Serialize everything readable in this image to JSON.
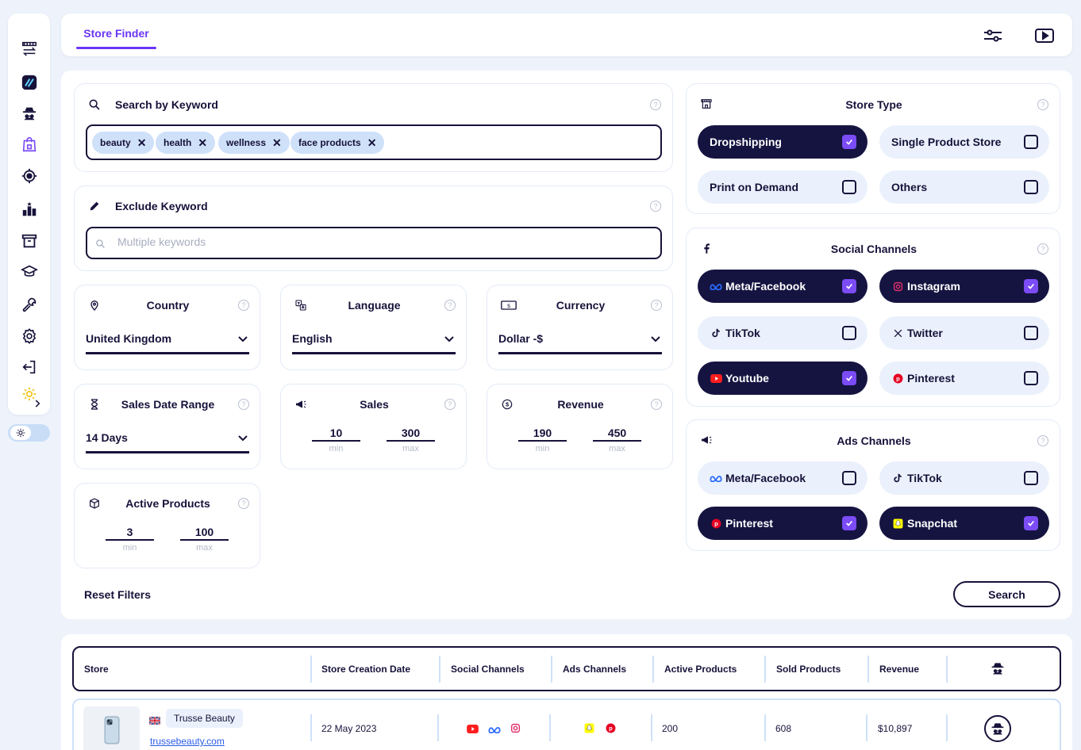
{
  "header": {
    "tab_label": "Store Finder"
  },
  "keyword": {
    "title": "Search by Keyword",
    "chips": [
      "beauty",
      "health",
      "wellness",
      "face products"
    ]
  },
  "exclude": {
    "title": "Exclude Keyword",
    "placeholder": "Multiple keywords"
  },
  "country": {
    "title": "Country",
    "value": "United Kingdom"
  },
  "language": {
    "title": "Language",
    "value": "English"
  },
  "currency": {
    "title": "Currency",
    "value": "Dollar -$"
  },
  "sales_date": {
    "title": "Sales Date Range",
    "value": "14 Days"
  },
  "sales": {
    "title": "Sales",
    "min": "10",
    "max": "300",
    "min_label": "min",
    "max_label": "max"
  },
  "revenue": {
    "title": "Revenue",
    "min": "190",
    "max": "450",
    "min_label": "min",
    "max_label": "max"
  },
  "active_products": {
    "title": "Active Products",
    "min": "3",
    "max": "100",
    "min_label": "min",
    "max_label": "max"
  },
  "store_type": {
    "title": "Store Type",
    "options": [
      {
        "label": "Dropshipping",
        "checked": true
      },
      {
        "label": "Single Product Store",
        "checked": false
      },
      {
        "label": "Print on Demand",
        "checked": false
      },
      {
        "label": "Others",
        "checked": false
      }
    ]
  },
  "social_channels": {
    "title": "Social Channels",
    "options": [
      {
        "label": "Meta/Facebook",
        "checked": true,
        "icon": "meta-icon"
      },
      {
        "label": "Instagram",
        "checked": true,
        "icon": "instagram-icon"
      },
      {
        "label": "TikTok",
        "checked": false,
        "icon": "tiktok-icon"
      },
      {
        "label": "Twitter",
        "checked": false,
        "icon": "x-icon"
      },
      {
        "label": "Youtube",
        "checked": true,
        "icon": "youtube-icon"
      },
      {
        "label": "Pinterest",
        "checked": false,
        "icon": "pinterest-icon"
      }
    ]
  },
  "ads_channels": {
    "title": "Ads Channels",
    "options": [
      {
        "label": "Meta/Facebook",
        "checked": false,
        "icon": "meta-icon"
      },
      {
        "label": "TikTok",
        "checked": false,
        "icon": "tiktok-icon"
      },
      {
        "label": "Pinterest",
        "checked": true,
        "icon": "pinterest-icon"
      },
      {
        "label": "Snapchat",
        "checked": true,
        "icon": "snapchat-icon"
      }
    ]
  },
  "actions": {
    "reset_label": "Reset Filters",
    "search_label": "Search"
  },
  "table": {
    "columns": [
      "Store",
      "Store Creation Date",
      "Social Channels",
      "Ads Channels",
      "Active Products",
      "Sold Products",
      "Revenue"
    ],
    "rows": [
      {
        "store_name": "Trusse Beauty",
        "store_url": "trussebeauty.com",
        "creation_date": "22 May 2023",
        "active_products": "200",
        "sold_products": "608",
        "revenue": "$10,897"
      }
    ]
  },
  "colors": {
    "accent": "#6a35f5",
    "navy": "#151441",
    "check": "#7b4cf6",
    "chip_bg": "#cfe1f9",
    "page_bg": "#eef3fb"
  }
}
